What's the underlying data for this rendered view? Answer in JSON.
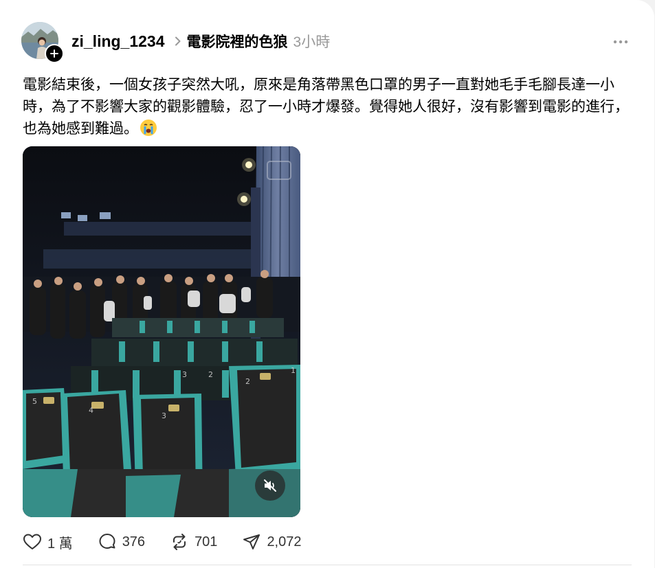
{
  "post": {
    "username": "zi_ling_1234",
    "topic": "電影院裡的色狼",
    "time": "3小時",
    "text": "電影結束後，一個女孩子突然大吼，原來是角落帶黑色口罩的男子一直對她毛手毛腳長達一小時，為了不影響大家的觀影體驗，忍了一小時才爆發。覺得她人很好，沒有影響到電影的進行，也為她感到難過。",
    "emoji": "crying-face"
  },
  "stats": {
    "likes": "1 萬",
    "comments": "376",
    "reposts": "701",
    "shares": "2,072"
  },
  "media": {
    "muted": true,
    "seat_numbers": [
      "5",
      "4",
      "3",
      "2",
      "1",
      "3",
      "2"
    ]
  },
  "icons": {
    "like": "heart-icon",
    "comment": "comment-bubble-icon",
    "repost": "repost-icon",
    "share": "send-icon",
    "more": "more-dots-icon",
    "mute": "speaker-muted-icon",
    "follow": "plus-icon",
    "topic_separator": "chevron-right-icon"
  },
  "colors": {
    "seat_teal": "#3aa7a0",
    "seat_back": "#242424",
    "muted_text": "#999999",
    "background": "#ffffff"
  }
}
